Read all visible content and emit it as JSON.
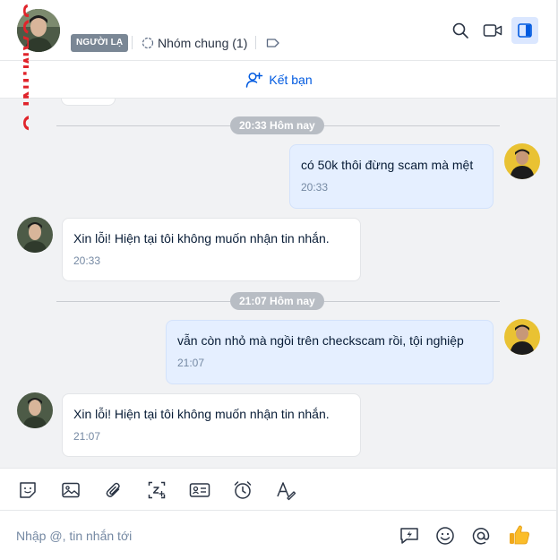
{
  "watermark": "SCAM.INFO",
  "header": {
    "badge": "NGƯỜI LẠ",
    "group_label": "Nhóm chung (1)",
    "icons": [
      "search-icon",
      "video-call-icon",
      "sidebar-toggle-icon"
    ]
  },
  "friend_bar": {
    "label": "Kết bạn",
    "icon": "add-friend-icon"
  },
  "messages": [
    {
      "type": "divider",
      "label": "20:33 Hôm nay"
    },
    {
      "type": "me",
      "text": "có 50k thôi đừng scam mà mệt",
      "time": "20:33"
    },
    {
      "type": "other",
      "text": "Xin lỗi! Hiện tại tôi không muốn nhận tin nhắn.",
      "time": "20:33"
    },
    {
      "type": "divider",
      "label": "21:07 Hôm nay"
    },
    {
      "type": "me",
      "text": "vẫn còn nhỏ mà ngồi trên checkscam rồi, tội nghiệp",
      "time": "21:07"
    },
    {
      "type": "other",
      "text": "Xin lỗi! Hiện tại tôi không muốn nhận tin nhắn.",
      "time": "21:07"
    }
  ],
  "toolbar": {
    "icons": [
      "sticker-icon",
      "image-icon",
      "attachment-icon",
      "screenshot-icon",
      "contact-card-icon",
      "reminder-icon",
      "text-format-icon"
    ]
  },
  "composer": {
    "placeholder": "Nhập @, tin nhắn tới",
    "icons": [
      "quick-message-icon",
      "emoji-icon",
      "mention-icon",
      "thumbs-up-icon"
    ]
  },
  "colors": {
    "accent": "#005ae0",
    "my_bubble": "#e5efff",
    "chat_bg": "#f1f2f4",
    "badge": "#7a8795"
  }
}
